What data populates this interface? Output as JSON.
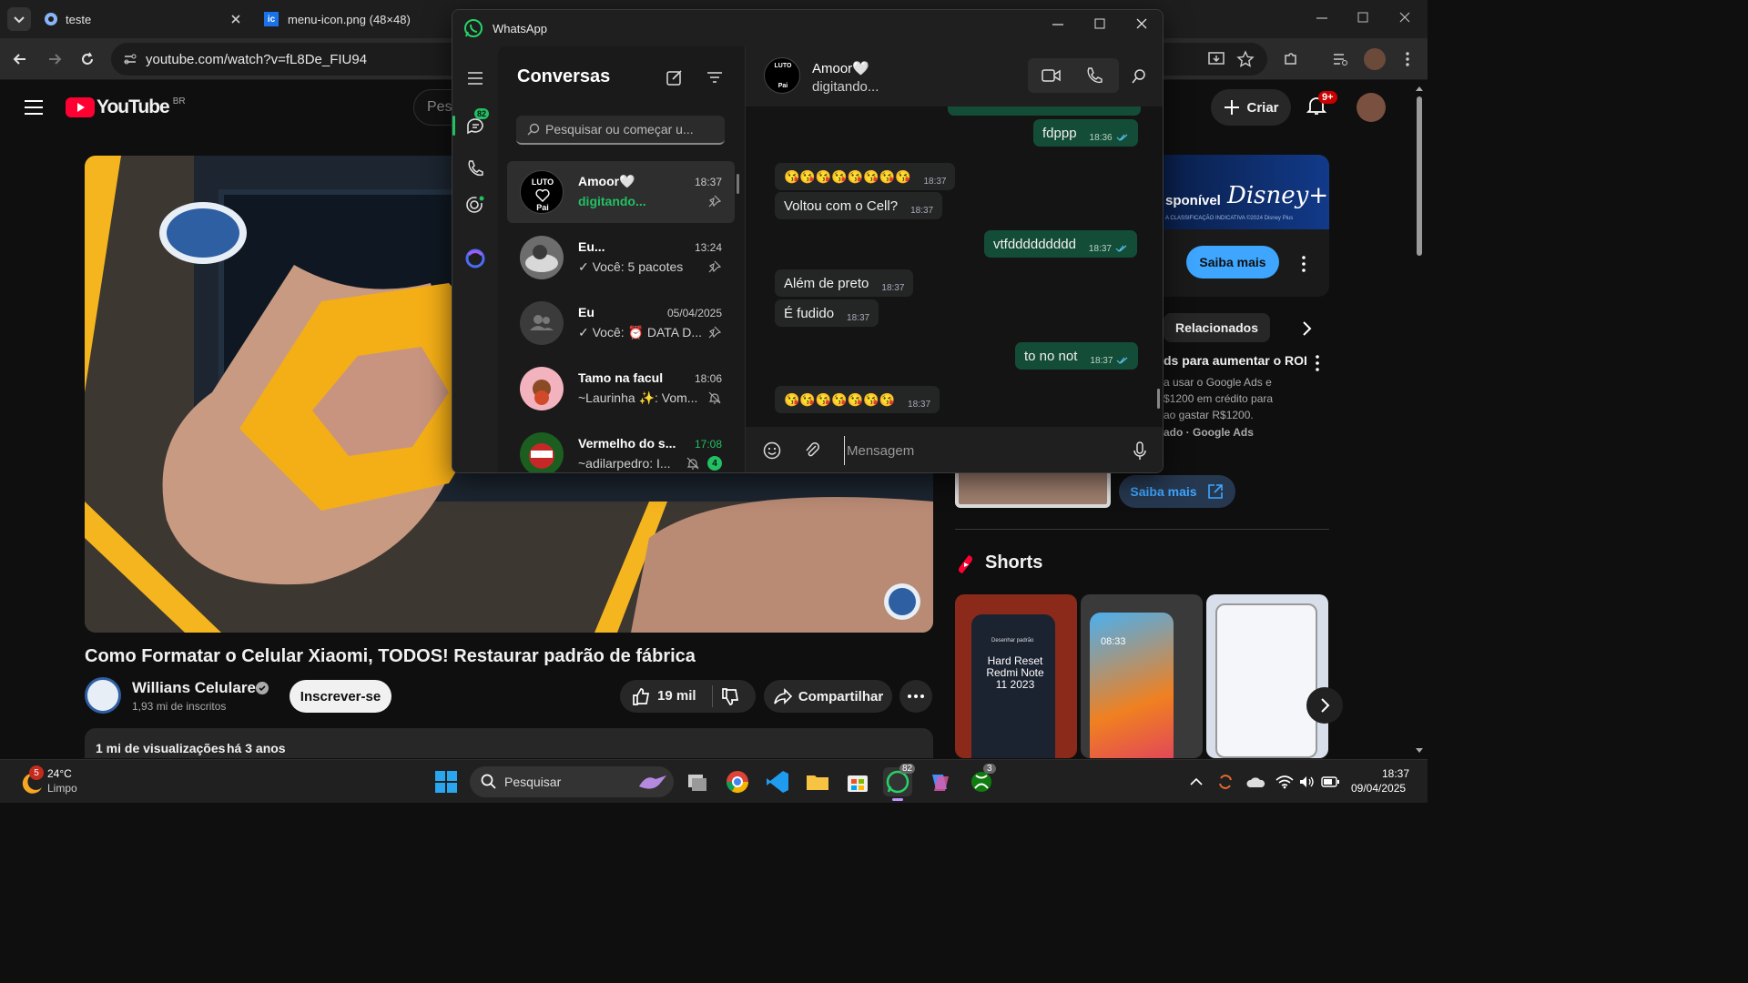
{
  "browser": {
    "tabs": [
      {
        "label": "teste"
      },
      {
        "label": "menu-icon.png (48×48)"
      }
    ],
    "url": "youtube.com/watch?v=fL8De_FIU94"
  },
  "youtube": {
    "logo_text": "YouTube",
    "region": "BR",
    "search_placeholder": "Pes",
    "create_label": "Criar",
    "notif_count": "9+",
    "video_title": "Como Formatar o Celular Xiaomi, TODOS! Restaurar padrão de fábrica",
    "channel_name": "Willians Celulares",
    "subscribers": "1,93 mi de inscritos",
    "subscribe_label": "Inscrever-se",
    "likes": "19 mil",
    "share_label": "Compartilhar",
    "views": "1 mi de visualizações",
    "age": "há 3 anos",
    "ad_badge": "sponível",
    "ad_sub": "A CLASSIFICAÇÃO INDICATIVA ©2024 Disney Plus",
    "ad_cta": "Saiba mais",
    "related_tab": "Relacionados",
    "ad2_title": "ds para aumentar o ROI",
    "ad2_desc": [
      "a usar o Google Ads e",
      "$1200 em crédito para",
      "ao gastar R$1200."
    ],
    "ad2_sponsor": "ado · Google Ads",
    "ad2_cta": "Saiba mais",
    "shorts_title": "Shorts",
    "short1_caption": "Hard Reset Redmi Note 11 2023",
    "short1_small": "Desenhar padrão",
    "short2_time": "08:33"
  },
  "whatsapp": {
    "window_title": "WhatsApp",
    "rail_badge": "82",
    "list_title": "Conversas",
    "search_placeholder": "Pesquisar ou começar u...",
    "chats": [
      {
        "name": "Amoor🤍",
        "time": "18:37",
        "preview": "digitando...",
        "icon": "pin-icon"
      },
      {
        "name": "Eu...",
        "time": "13:24",
        "preview": "✓ Você: 5 pacotes",
        "icon": "pin-icon"
      },
      {
        "name": "Eu",
        "time": "05/04/2025",
        "preview": "✓ Você: ⏰ DATA D...",
        "icon": "pin-icon"
      },
      {
        "name": "Tamo na facul",
        "time": "18:06",
        "preview": "~Laurinha ✨: Vom...",
        "icon": "muted-icon"
      },
      {
        "name": "Vermelho do s...",
        "time": "17:08",
        "preview": "~adilarpedro: I...",
        "icon": "muted-icon",
        "unread": "4"
      }
    ],
    "avatar_text": [
      "LUTO",
      "Pai"
    ],
    "header_name": "Amoor🤍",
    "header_status": "digitando...",
    "messages": [
      {
        "dir": "out",
        "text": "fdppp",
        "time": "18:36"
      },
      {
        "dir": "in",
        "text": "😘😘😘😘😘😘😘😘",
        "time": "18:37"
      },
      {
        "dir": "in",
        "text": "Voltou com o Cell?",
        "time": "18:37"
      },
      {
        "dir": "out",
        "text": "vtfddddddddd",
        "time": "18:37"
      },
      {
        "dir": "in",
        "text": "Além de preto",
        "time": "18:37"
      },
      {
        "dir": "in",
        "text": "É fudido",
        "time": "18:37"
      },
      {
        "dir": "out",
        "text": "to no not",
        "time": "18:37"
      },
      {
        "dir": "in",
        "text": "😘😘😘😘😘😘😘",
        "time": "18:37"
      }
    ],
    "composer_placeholder": "Mensagem"
  },
  "taskbar": {
    "weather_temp": "24°C",
    "weather_desc": "Limpo",
    "weather_badge": "5",
    "search_label": "Pesquisar",
    "whatsapp_badge": "82",
    "xbox_badge": "3",
    "time": "18:37",
    "date": "09/04/2025"
  },
  "colors": {
    "wa_green": "#21c063",
    "yt_red": "#ff0033",
    "out_bubble": "#144d37"
  }
}
